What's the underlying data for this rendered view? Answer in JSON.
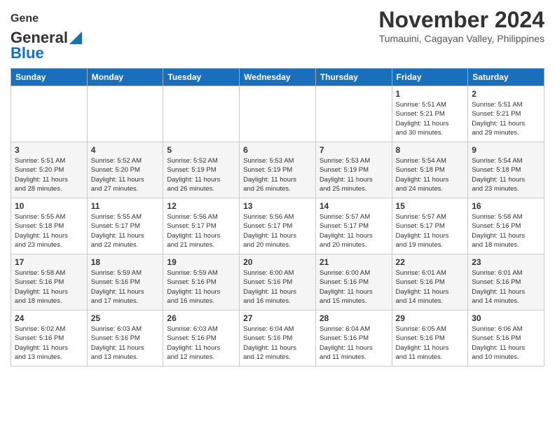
{
  "header": {
    "logo_general": "General",
    "logo_blue": "Blue",
    "month_title": "November 2024",
    "location": "Tumauini, Cagayan Valley, Philippines"
  },
  "weekdays": [
    "Sunday",
    "Monday",
    "Tuesday",
    "Wednesday",
    "Thursday",
    "Friday",
    "Saturday"
  ],
  "weeks": [
    [
      {
        "day": "",
        "info": ""
      },
      {
        "day": "",
        "info": ""
      },
      {
        "day": "",
        "info": ""
      },
      {
        "day": "",
        "info": ""
      },
      {
        "day": "",
        "info": ""
      },
      {
        "day": "1",
        "info": "Sunrise: 5:51 AM\nSunset: 5:21 PM\nDaylight: 11 hours\nand 30 minutes."
      },
      {
        "day": "2",
        "info": "Sunrise: 5:51 AM\nSunset: 5:21 PM\nDaylight: 11 hours\nand 29 minutes."
      }
    ],
    [
      {
        "day": "3",
        "info": "Sunrise: 5:51 AM\nSunset: 5:20 PM\nDaylight: 11 hours\nand 28 minutes."
      },
      {
        "day": "4",
        "info": "Sunrise: 5:52 AM\nSunset: 5:20 PM\nDaylight: 11 hours\nand 27 minutes."
      },
      {
        "day": "5",
        "info": "Sunrise: 5:52 AM\nSunset: 5:19 PM\nDaylight: 11 hours\nand 26 minutes."
      },
      {
        "day": "6",
        "info": "Sunrise: 5:53 AM\nSunset: 5:19 PM\nDaylight: 11 hours\nand 26 minutes."
      },
      {
        "day": "7",
        "info": "Sunrise: 5:53 AM\nSunset: 5:19 PM\nDaylight: 11 hours\nand 25 minutes."
      },
      {
        "day": "8",
        "info": "Sunrise: 5:54 AM\nSunset: 5:18 PM\nDaylight: 11 hours\nand 24 minutes."
      },
      {
        "day": "9",
        "info": "Sunrise: 5:54 AM\nSunset: 5:18 PM\nDaylight: 11 hours\nand 23 minutes."
      }
    ],
    [
      {
        "day": "10",
        "info": "Sunrise: 5:55 AM\nSunset: 5:18 PM\nDaylight: 11 hours\nand 23 minutes."
      },
      {
        "day": "11",
        "info": "Sunrise: 5:55 AM\nSunset: 5:17 PM\nDaylight: 11 hours\nand 22 minutes."
      },
      {
        "day": "12",
        "info": "Sunrise: 5:56 AM\nSunset: 5:17 PM\nDaylight: 11 hours\nand 21 minutes."
      },
      {
        "day": "13",
        "info": "Sunrise: 5:56 AM\nSunset: 5:17 PM\nDaylight: 11 hours\nand 20 minutes."
      },
      {
        "day": "14",
        "info": "Sunrise: 5:57 AM\nSunset: 5:17 PM\nDaylight: 11 hours\nand 20 minutes."
      },
      {
        "day": "15",
        "info": "Sunrise: 5:57 AM\nSunset: 5:17 PM\nDaylight: 11 hours\nand 19 minutes."
      },
      {
        "day": "16",
        "info": "Sunrise: 5:58 AM\nSunset: 5:16 PM\nDaylight: 11 hours\nand 18 minutes."
      }
    ],
    [
      {
        "day": "17",
        "info": "Sunrise: 5:58 AM\nSunset: 5:16 PM\nDaylight: 11 hours\nand 18 minutes."
      },
      {
        "day": "18",
        "info": "Sunrise: 5:59 AM\nSunset: 5:16 PM\nDaylight: 11 hours\nand 17 minutes."
      },
      {
        "day": "19",
        "info": "Sunrise: 5:59 AM\nSunset: 5:16 PM\nDaylight: 11 hours\nand 16 minutes."
      },
      {
        "day": "20",
        "info": "Sunrise: 6:00 AM\nSunset: 5:16 PM\nDaylight: 11 hours\nand 16 minutes."
      },
      {
        "day": "21",
        "info": "Sunrise: 6:00 AM\nSunset: 5:16 PM\nDaylight: 11 hours\nand 15 minutes."
      },
      {
        "day": "22",
        "info": "Sunrise: 6:01 AM\nSunset: 5:16 PM\nDaylight: 11 hours\nand 14 minutes."
      },
      {
        "day": "23",
        "info": "Sunrise: 6:01 AM\nSunset: 5:16 PM\nDaylight: 11 hours\nand 14 minutes."
      }
    ],
    [
      {
        "day": "24",
        "info": "Sunrise: 6:02 AM\nSunset: 5:16 PM\nDaylight: 11 hours\nand 13 minutes."
      },
      {
        "day": "25",
        "info": "Sunrise: 6:03 AM\nSunset: 5:16 PM\nDaylight: 11 hours\nand 13 minutes."
      },
      {
        "day": "26",
        "info": "Sunrise: 6:03 AM\nSunset: 5:16 PM\nDaylight: 11 hours\nand 12 minutes."
      },
      {
        "day": "27",
        "info": "Sunrise: 6:04 AM\nSunset: 5:16 PM\nDaylight: 11 hours\nand 12 minutes."
      },
      {
        "day": "28",
        "info": "Sunrise: 6:04 AM\nSunset: 5:16 PM\nDaylight: 11 hours\nand 11 minutes."
      },
      {
        "day": "29",
        "info": "Sunrise: 6:05 AM\nSunset: 5:16 PM\nDaylight: 11 hours\nand 11 minutes."
      },
      {
        "day": "30",
        "info": "Sunrise: 6:06 AM\nSunset: 5:16 PM\nDaylight: 11 hours\nand 10 minutes."
      }
    ]
  ]
}
